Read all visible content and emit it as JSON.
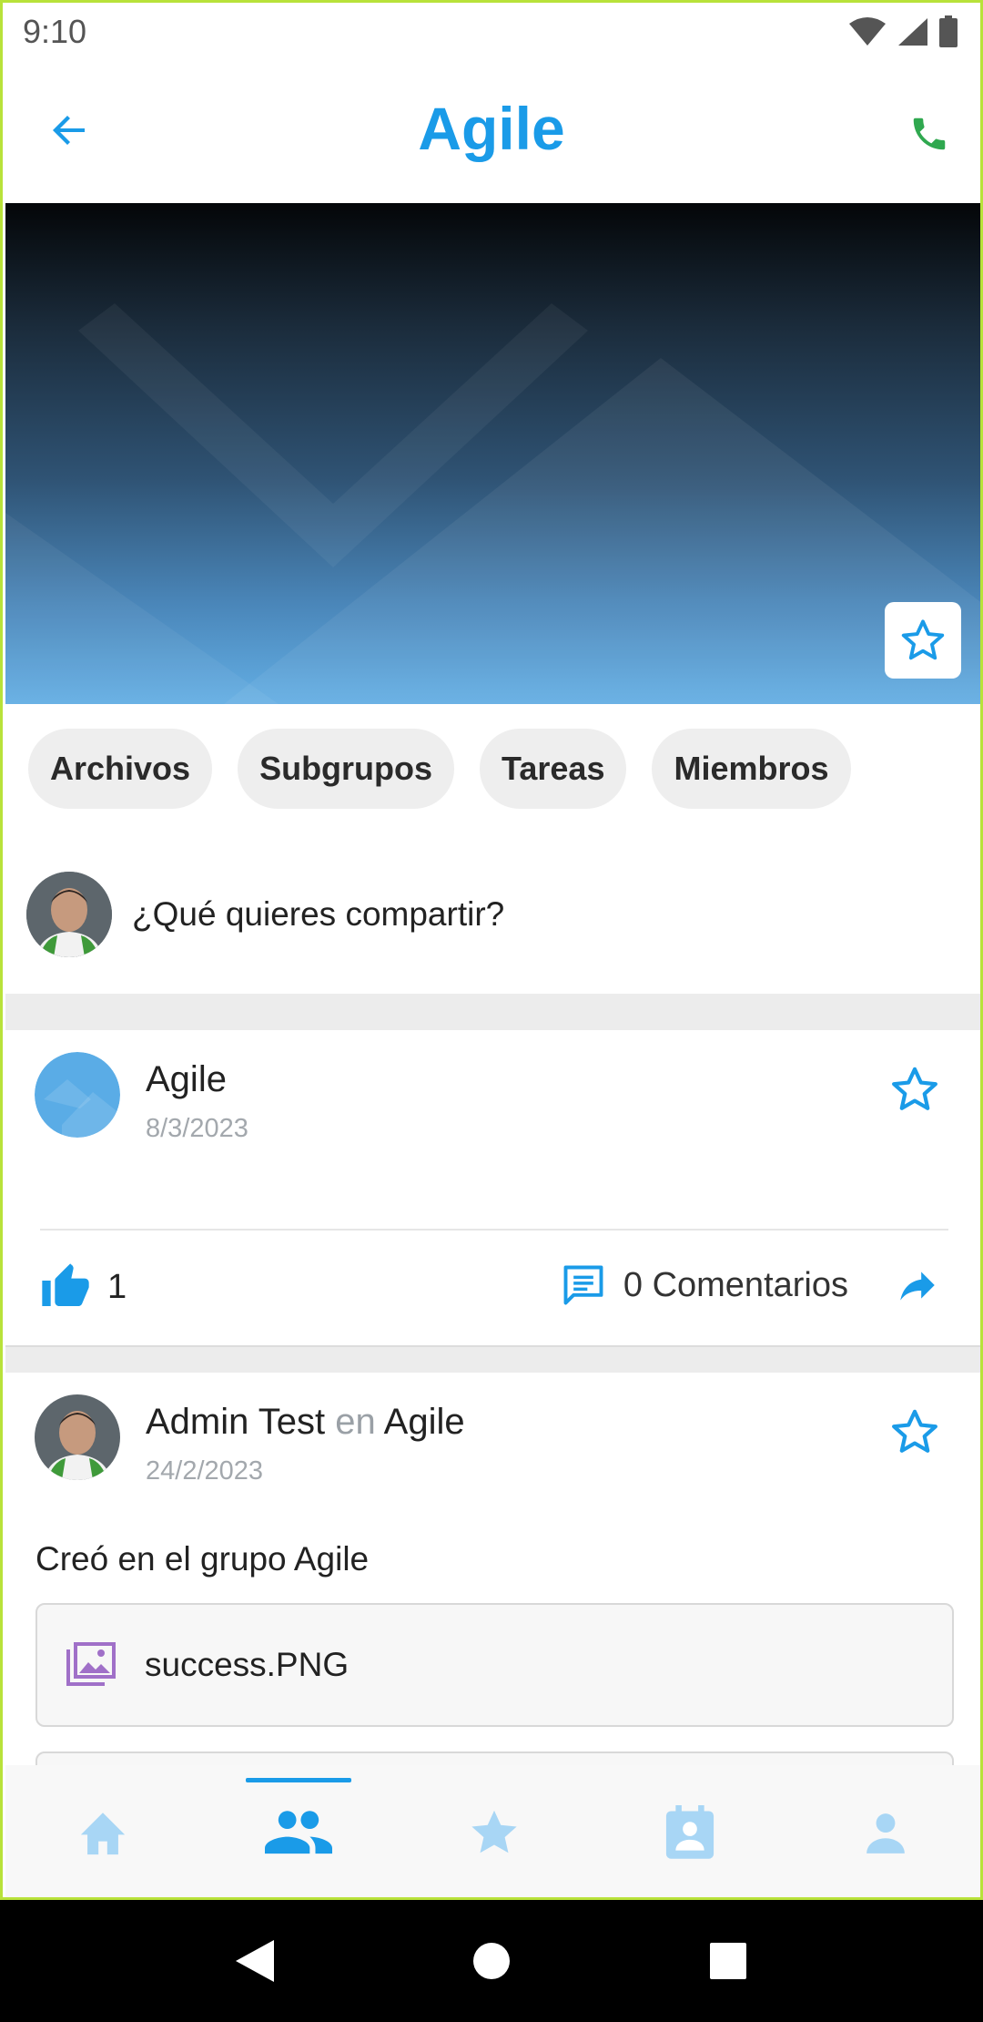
{
  "status_bar": {
    "time": "9:10"
  },
  "header": {
    "title": "Agile"
  },
  "chips": [
    "Archivos",
    "Subgrupos",
    "Tareas",
    "Miembros"
  ],
  "composer": {
    "prompt": "¿Qué quieres compartir?"
  },
  "posts": [
    {
      "author": "Agile",
      "date": "8/3/2023",
      "likes": "1",
      "comments": "0 Comentarios"
    },
    {
      "author": "Admin Test",
      "connector": "en",
      "group": "Agile",
      "date": "24/2/2023",
      "body": "Creó en el grupo Agile",
      "attachment": "success.PNG"
    }
  ],
  "bottom_nav": {
    "items": [
      "home-icon",
      "groups-icon",
      "favorites-icon",
      "calendar-badge-icon",
      "profile-icon"
    ],
    "active": "groups-icon"
  },
  "colors": {
    "accent": "#1a9be8",
    "nav_inactive": "#a8d6f5",
    "call": "#2fa84f",
    "attachment_icon": "#a070c8"
  }
}
